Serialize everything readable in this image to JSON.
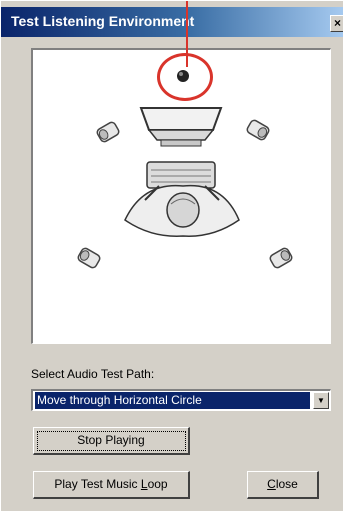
{
  "window": {
    "title": "Test Listening Environment",
    "close_glyph": "×"
  },
  "scene": {
    "description_icons": [
      "speaker-center-dot",
      "speaker-front-left",
      "speaker-front-right",
      "monitor",
      "keyboard",
      "listener",
      "speaker-rear-left",
      "speaker-rear-right"
    ]
  },
  "path_label": "Select Audio Test Path:",
  "path_select": {
    "value": "Move through Horizontal Circle",
    "arrow": "▼"
  },
  "buttons": {
    "stop": "Stop Playing",
    "play_loop_prefix": "Play Test Music ",
    "play_loop_underline": "L",
    "play_loop_suffix": "oop",
    "close_underline": "C",
    "close_suffix": "lose"
  },
  "colors": {
    "highlight": "#0a246a",
    "annotation": "#d9342b"
  }
}
